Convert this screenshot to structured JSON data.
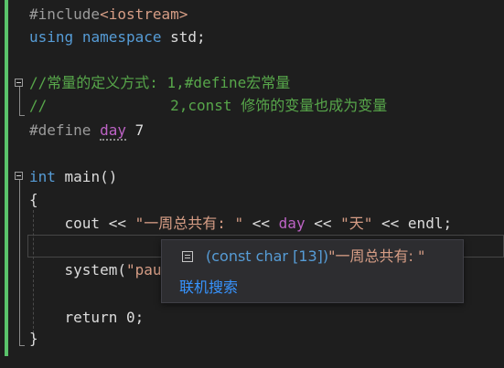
{
  "editor": {
    "lines": [
      {
        "parts": [
          {
            "t": "#include",
            "c": "pp"
          },
          {
            "t": "<iostream>",
            "c": "str"
          }
        ]
      },
      {
        "parts": [
          {
            "t": "using",
            "c": "kw"
          },
          {
            "t": " ",
            "c": "plain"
          },
          {
            "t": "namespace",
            "c": "kw"
          },
          {
            "t": " std;",
            "c": "plain"
          }
        ]
      },
      {
        "parts": []
      },
      {
        "parts": [
          {
            "t": "//常量的定义方式: 1,#define宏常量",
            "c": "cm"
          }
        ]
      },
      {
        "parts": [
          {
            "t": "//              2,const 修饰的变量也成为变量",
            "c": "cm"
          }
        ]
      },
      {
        "parts": [
          {
            "t": "#define",
            "c": "pp"
          },
          {
            "t": " ",
            "c": "plain"
          },
          {
            "t": "day",
            "c": "macro squiggle"
          },
          {
            "t": " 7",
            "c": "plain"
          }
        ]
      },
      {
        "parts": []
      },
      {
        "parts": [
          {
            "t": "int",
            "c": "kw"
          },
          {
            "t": " main()",
            "c": "plain"
          }
        ]
      },
      {
        "parts": [
          {
            "t": "{",
            "c": "plain"
          }
        ]
      },
      {
        "parts": [
          {
            "t": "    cout << ",
            "c": "plain"
          },
          {
            "t": "\"一周总共有: \"",
            "c": "str"
          },
          {
            "t": " << ",
            "c": "plain"
          },
          {
            "t": "day",
            "c": "macro"
          },
          {
            "t": " << ",
            "c": "plain"
          },
          {
            "t": "\"天\"",
            "c": "str"
          },
          {
            "t": " << endl;",
            "c": "plain"
          }
        ]
      },
      {
        "parts": []
      },
      {
        "parts": [
          {
            "t": "    system(",
            "c": "plain"
          },
          {
            "t": "\"pau",
            "c": "str"
          }
        ]
      },
      {
        "parts": []
      },
      {
        "parts": [
          {
            "t": "    return 0;",
            "c": "plain"
          }
        ]
      },
      {
        "parts": [
          {
            "t": "}",
            "c": "plain"
          }
        ]
      }
    ]
  },
  "tooltip": {
    "type_text": "(const char [13])",
    "value_text": "\"一周总共有: \"",
    "search_link": "联机搜索"
  },
  "colors": {
    "background": "#1e1e1e",
    "keyword": "#569cd6",
    "comment": "#57a64a",
    "string": "#d69d85",
    "macro": "#bd63c5",
    "link": "#3794ff",
    "change_bar": "#5ac36b"
  }
}
